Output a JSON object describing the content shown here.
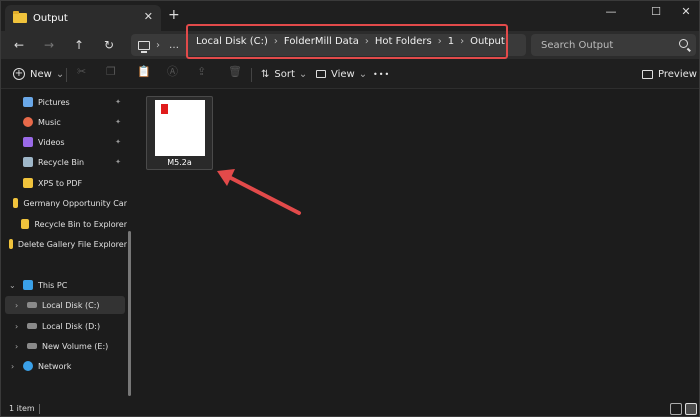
{
  "window": {
    "tab_title": "Output",
    "new_tab_glyph": "+",
    "close_tab_glyph": "✕",
    "minimize_glyph": "—",
    "maximize_glyph": "☐",
    "close_glyph": "✕"
  },
  "nav": {
    "back_glyph": "←",
    "forward_glyph": "→",
    "up_glyph": "↑",
    "refresh_glyph": "↻"
  },
  "address": {
    "more_glyph": "…",
    "separator": "›",
    "crumbs": [
      "Local Disk (C:)",
      "FolderMill Data",
      "Hot Folders",
      "1",
      "Output"
    ]
  },
  "search": {
    "placeholder": "Search Output"
  },
  "toolbar": {
    "new_label": "New",
    "sort_label": "Sort",
    "view_label": "View",
    "more_glyph": "•••",
    "preview_label": "Preview",
    "dropdown_glyph": "⌄"
  },
  "sidebar": {
    "items": [
      {
        "label": "Pictures",
        "icon": "pictures-icon",
        "pinned": true
      },
      {
        "label": "Music",
        "icon": "music-icon",
        "pinned": true
      },
      {
        "label": "Videos",
        "icon": "videos-icon",
        "pinned": true
      },
      {
        "label": "Recycle Bin",
        "icon": "recycle-bin-icon",
        "pinned": true
      },
      {
        "label": "XPS to PDF",
        "icon": "folder-icon",
        "pinned": false
      },
      {
        "label": "Germany Opportunity Car",
        "icon": "folder-icon",
        "pinned": false
      },
      {
        "label": "Recycle Bin to Explorer",
        "icon": "folder-icon",
        "pinned": false
      },
      {
        "label": "Delete Gallery File Explorer",
        "icon": "folder-icon",
        "pinned": false
      }
    ],
    "tree": [
      {
        "label": "This PC",
        "icon": "this-pc-icon",
        "expanded": true
      },
      {
        "label": "Local Disk (C:)",
        "icon": "drive-icon",
        "selected": true
      },
      {
        "label": "Local Disk (D:)",
        "icon": "drive-icon"
      },
      {
        "label": "New Volume (E:)",
        "icon": "drive-icon"
      },
      {
        "label": "Network",
        "icon": "network-icon"
      }
    ],
    "pin_glyph": "📌",
    "chevron_right": "›",
    "chevron_down": "⌄"
  },
  "files": [
    {
      "name": "M5.2a",
      "type": "pdf"
    }
  ],
  "status": {
    "count": "1 item"
  },
  "colors": {
    "highlight": "#e24a4a",
    "arrow": "#e24a4a"
  }
}
